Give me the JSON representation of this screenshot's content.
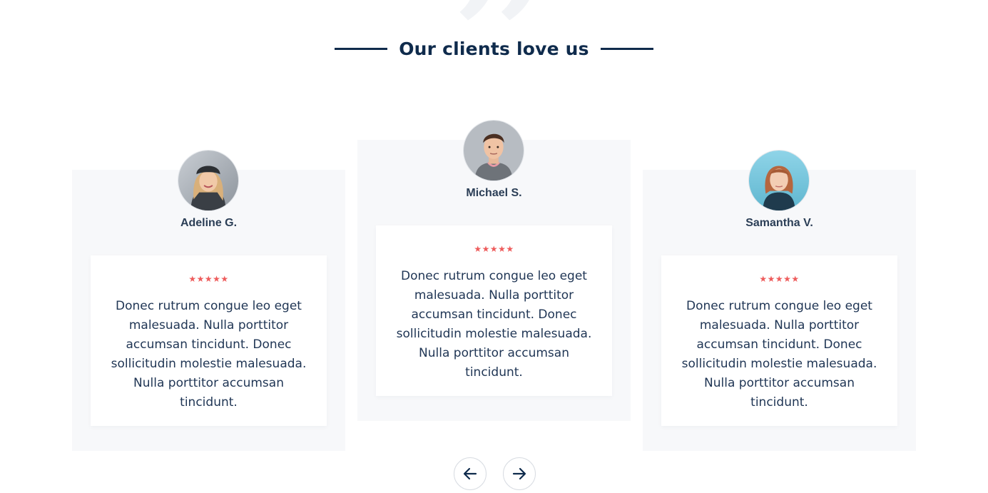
{
  "section": {
    "title": "Our clients love us"
  },
  "colors": {
    "title": "#0f2b4c",
    "card_bg": "#f7f8fa",
    "star": "#ee5c5c"
  },
  "testimonials": [
    {
      "name": "Adeline G.",
      "rating": 5,
      "stars": "★★★★★",
      "text": "Donec rutrum congue leo eget malesuada. Nulla porttitor accumsan tincidunt. Donec sollicitudin molestie malesuada. Nulla porttitor accumsan tincidunt."
    },
    {
      "name": "Michael S.",
      "rating": 5,
      "stars": "★★★★★",
      "text": "Donec rutrum congue leo eget malesuada. Nulla porttitor accumsan tincidunt. Donec sollicitudin molestie malesuada. Nulla porttitor accumsan tincidunt."
    },
    {
      "name": "Samantha V.",
      "rating": 5,
      "stars": "★★★★★",
      "text": "Donec rutrum congue leo eget malesuada. Nulla porttitor accumsan tincidunt. Donec sollicitudin molestie malesuada. Nulla porttitor accumsan tincidunt."
    }
  ],
  "navigation": {
    "prev_icon": "arrow-left-icon",
    "next_icon": "arrow-right-icon"
  }
}
